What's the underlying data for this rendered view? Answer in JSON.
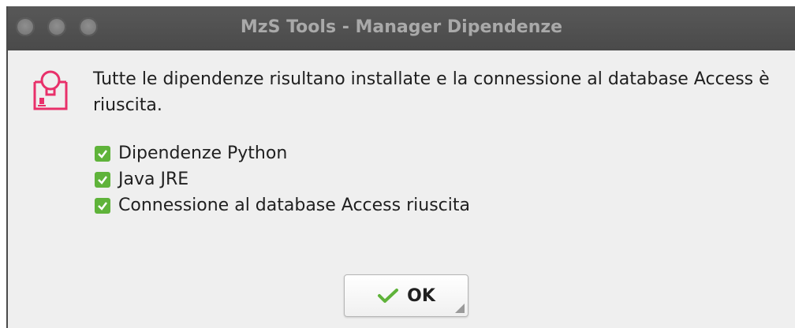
{
  "window": {
    "title": "MzS Tools - Manager Dipendenze"
  },
  "dialog": {
    "message": "Tutte le dipendenze risultano installate e la connessione al database Access è riuscita.",
    "checks": [
      {
        "label": "Dipendenze Python",
        "icon": "check-box-icon"
      },
      {
        "label": "Java JRE",
        "icon": "check-box-icon"
      },
      {
        "label": "Connessione al database Access riuscita",
        "icon": "check-box-icon"
      }
    ],
    "ok_label": "OK"
  },
  "colors": {
    "titlebar": "#4a4a4a",
    "title_text": "#a9a9a9",
    "dialog_bg": "#efefef",
    "check_green": "#5fb33a",
    "alert_icon_pink": "#e8306a"
  }
}
